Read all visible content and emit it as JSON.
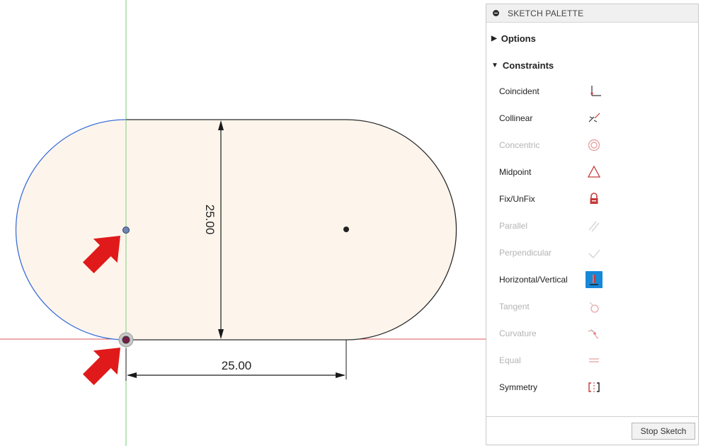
{
  "canvas": {
    "dimension_vertical": "25.00",
    "dimension_horizontal": "25.00",
    "colors": {
      "fill": "#fdf5ec",
      "outline": "#2a2a2a",
      "selected_arc": "#3a6fd8",
      "axis_x": "#e05656",
      "axis_y": "#6fcf6f",
      "arrow": "#e01a1a"
    }
  },
  "palette": {
    "title": "SKETCH PALETTE",
    "options_label": "Options",
    "constraints_label": "Constraints",
    "constraints": [
      {
        "label": "Coincident",
        "icon": "coincident-icon",
        "enabled": true
      },
      {
        "label": "Collinear",
        "icon": "collinear-icon",
        "enabled": true
      },
      {
        "label": "Concentric",
        "icon": "concentric-icon",
        "enabled": false
      },
      {
        "label": "Midpoint",
        "icon": "midpoint-icon",
        "enabled": true
      },
      {
        "label": "Fix/UnFix",
        "icon": "lock-icon",
        "enabled": true
      },
      {
        "label": "Parallel",
        "icon": "parallel-icon",
        "enabled": false
      },
      {
        "label": "Perpendicular",
        "icon": "perpendicular-icon",
        "enabled": false
      },
      {
        "label": "Horizontal/Vertical",
        "icon": "horizontal-vertical-icon",
        "enabled": true,
        "active": true
      },
      {
        "label": "Tangent",
        "icon": "tangent-icon",
        "enabled": false
      },
      {
        "label": "Curvature",
        "icon": "curvature-icon",
        "enabled": false
      },
      {
        "label": "Equal",
        "icon": "equal-icon",
        "enabled": false
      },
      {
        "label": "Symmetry",
        "icon": "symmetry-icon",
        "enabled": true
      }
    ],
    "stop_button": "Stop Sketch"
  }
}
